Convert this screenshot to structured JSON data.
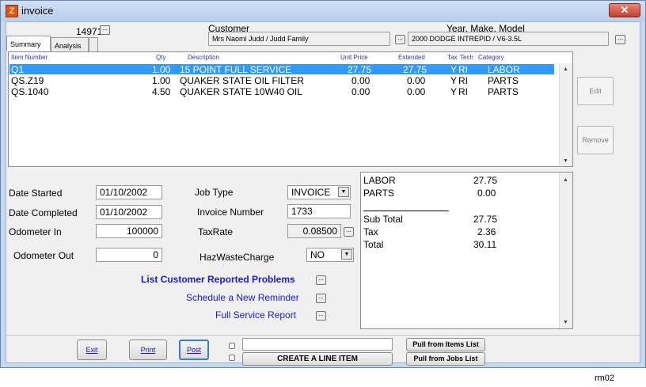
{
  "window": {
    "title": "invoice",
    "close_glyph": "✕"
  },
  "header": {
    "invoice_id": "14971",
    "customer_label": "Customer",
    "customer_value": "Mrs Naomi Judd / Judd Family",
    "vehicle_label": "Year, Make, Model",
    "vehicle_value": "2000 DODGE INTREPID / V6-3.5L"
  },
  "tabs": [
    {
      "label": "Summary"
    },
    {
      "label": "Analysis"
    }
  ],
  "grid": {
    "columns": [
      "Item Number",
      "Qty",
      "Description",
      "Unit Price",
      "Extended",
      "Tax",
      "Tech",
      "Category"
    ],
    "rows": [
      {
        "item": "Q1",
        "qty": "1.00",
        "desc": "15 POINT FULL SERVICE",
        "unit": "27.75",
        "ext": "27.75",
        "tax": "Y",
        "tech": "RI",
        "cat": "LABOR"
      },
      {
        "item": "QS.Z19",
        "qty": "1.00",
        "desc": "QUAKER STATE OIL FILTER",
        "unit": "0.00",
        "ext": "0.00",
        "tax": "Y",
        "tech": "RI",
        "cat": "PARTS"
      },
      {
        "item": "QS.1040",
        "qty": "4.50",
        "desc": "QUAKER STATE 10W40 OIL",
        "unit": "0.00",
        "ext": "0.00",
        "tax": "Y",
        "tech": "RI",
        "cat": "PARTS"
      }
    ]
  },
  "side_buttons": {
    "edit": "Edit",
    "remove": "Remove"
  },
  "form": {
    "date_started_label": "Date Started",
    "date_started": "01/10/2002",
    "date_completed_label": "Date Completed",
    "date_completed": "01/10/2002",
    "odometer_in_label": "Odometer In",
    "odometer_in": "100000",
    "odometer_out_label": "Odometer Out",
    "odometer_out": "0",
    "job_type_label": "Job Type",
    "job_type": "INVOICE",
    "invoice_number_label": "Invoice Number",
    "invoice_number": "1733",
    "tax_rate_label": "TaxRate",
    "tax_rate": "0.08500",
    "haz_label": "HazWasteCharge",
    "haz_value": "NO"
  },
  "links": {
    "problems": "List Customer Reported Problems",
    "reminder": "Schedule a New Reminder",
    "report": "Full Service Report"
  },
  "totals": {
    "labor_label": "LABOR",
    "labor": "27.75",
    "parts_label": "PARTS",
    "parts": "0.00",
    "subtotal_label": "Sub Total",
    "subtotal": "27.75",
    "tax_label": "Tax",
    "tax": "2.36",
    "total_label": "Total",
    "total": "30.11"
  },
  "buttons": {
    "exit": "Exit",
    "print": "Print",
    "post": "Post",
    "create_line": "CREATE A LINE ITEM",
    "pull_items": "Pull from Items List",
    "pull_jobs": "Pull from Jobs List"
  },
  "footer": {
    "code": "rm02"
  }
}
